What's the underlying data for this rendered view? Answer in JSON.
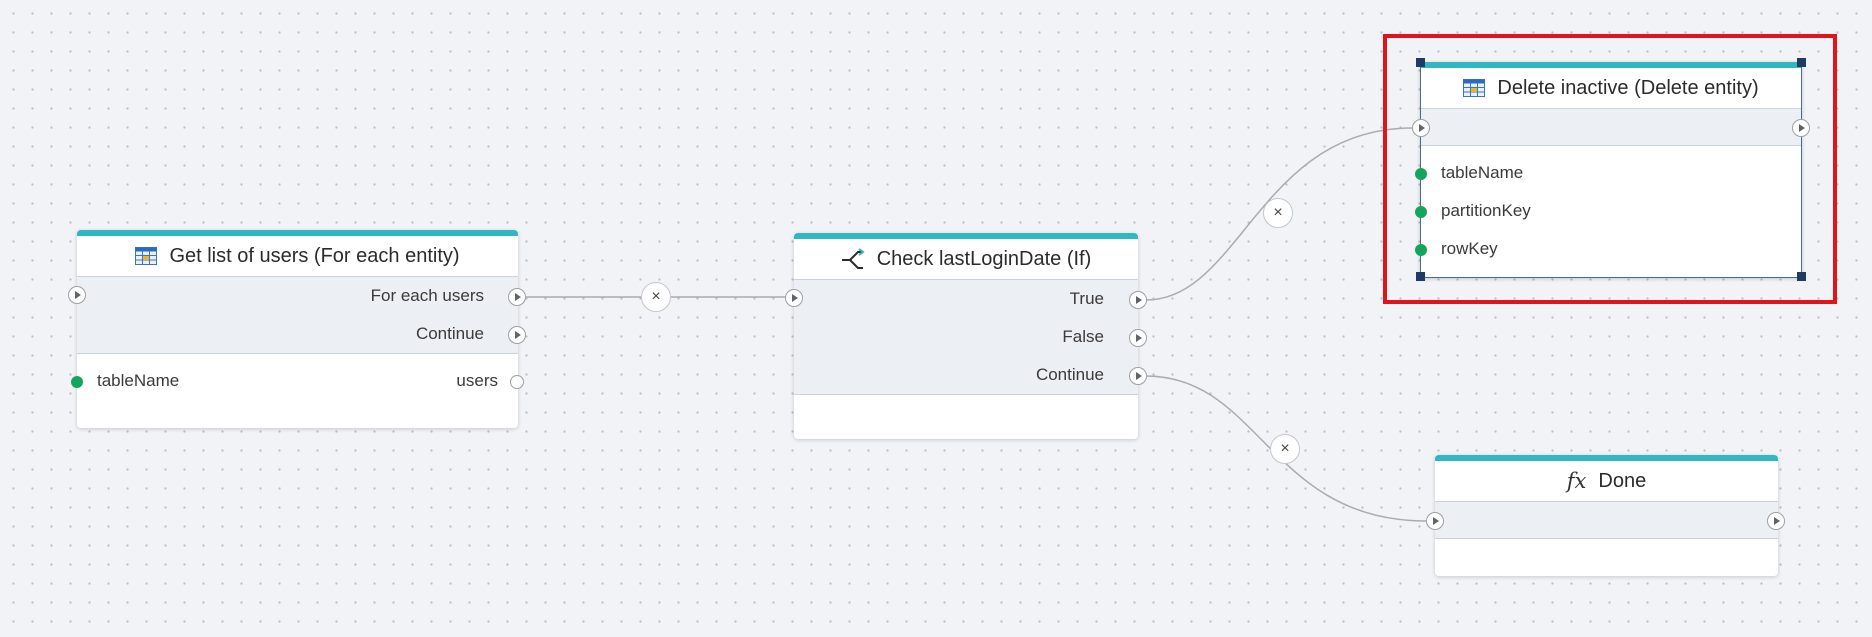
{
  "nodes": {
    "get_users": {
      "title": "Get list of users (For each entity)",
      "icon": "table-icon",
      "outputs": [
        "For each users",
        "Continue"
      ],
      "param_in": "tableName",
      "param_out": "users"
    },
    "check_login": {
      "title": "Check lastLoginDate (If)",
      "icon": "branch-icon",
      "outputs": [
        "True",
        "False",
        "Continue"
      ]
    },
    "delete_inactive": {
      "title": "Delete inactive (Delete entity)",
      "icon": "table-icon",
      "params": [
        "tableName",
        "partitionKey",
        "rowKey"
      ],
      "selected": true
    },
    "done": {
      "title": "Done",
      "icon": "fx-icon",
      "icon_text": "fx"
    }
  },
  "wire_button_symbol": "×",
  "colors": {
    "accent": "#2fb8c1",
    "param_dot": "#13a55a",
    "selection": "#e0151c",
    "selection_handle": "#1f3a64",
    "wire": "#a8abb0"
  }
}
